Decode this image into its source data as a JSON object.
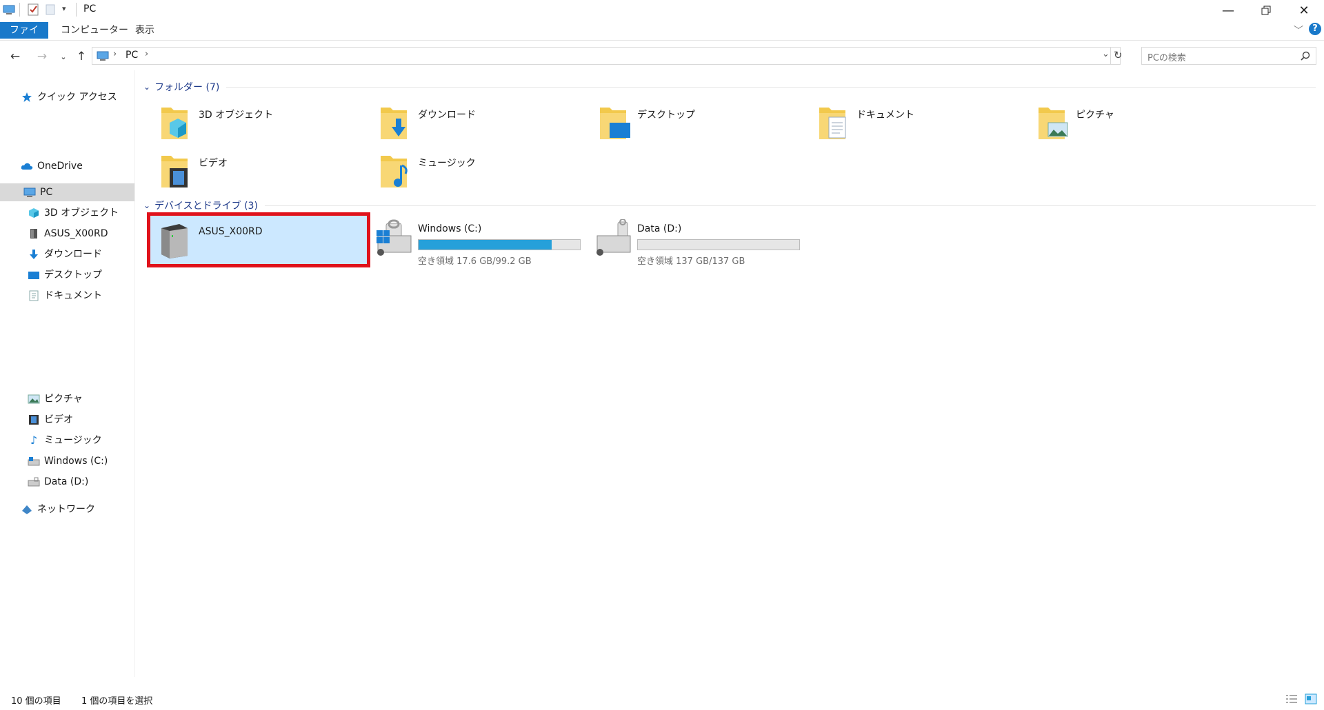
{
  "window": {
    "title": "PC",
    "minimize_icon": "minimize-icon",
    "maximize_icon": "restore-icon",
    "close_icon": "close-icon"
  },
  "ribbon": {
    "tabs": [
      "ファイル",
      "コンピューター",
      "表示"
    ]
  },
  "address": {
    "path": "PC",
    "search_placeholder": "PCの検索"
  },
  "nav": {
    "quick_access": "クイック アクセス",
    "onedrive": "OneDrive",
    "pc": "PC",
    "items": [
      "3D オブジェクト",
      "ASUS_X00RD",
      "ダウンロード",
      "デスクトップ",
      "ドキュメント",
      "ピクチャ",
      "ビデオ",
      "ミュージック",
      "Windows (C:)",
      "Data (D:)"
    ],
    "network": "ネットワーク"
  },
  "folders": {
    "header": "フォルダー (7)",
    "items": [
      "3D オブジェクト",
      "ダウンロード",
      "デスクトップ",
      "ドキュメント",
      "ピクチャ",
      "ビデオ",
      "ミュージック"
    ]
  },
  "devices": {
    "header": "デバイスとドライブ (3)",
    "device": "ASUS_X00RD",
    "drives": [
      {
        "name": "Windows (C:)",
        "free_text": "空き領域 17.6 GB/99.2 GB",
        "used_fraction": 0.823
      },
      {
        "name": "Data (D:)",
        "free_text": "空き領域 137 GB/137 GB",
        "used_fraction": 0.0
      }
    ]
  },
  "status": {
    "count": "10 個の項目",
    "selected": "1 個の項目を選択"
  },
  "colors": {
    "accent": "#1979ca",
    "selection": "#cce8ff",
    "highlight_border": "#e0121b",
    "bar_fill": "#26a0da"
  }
}
